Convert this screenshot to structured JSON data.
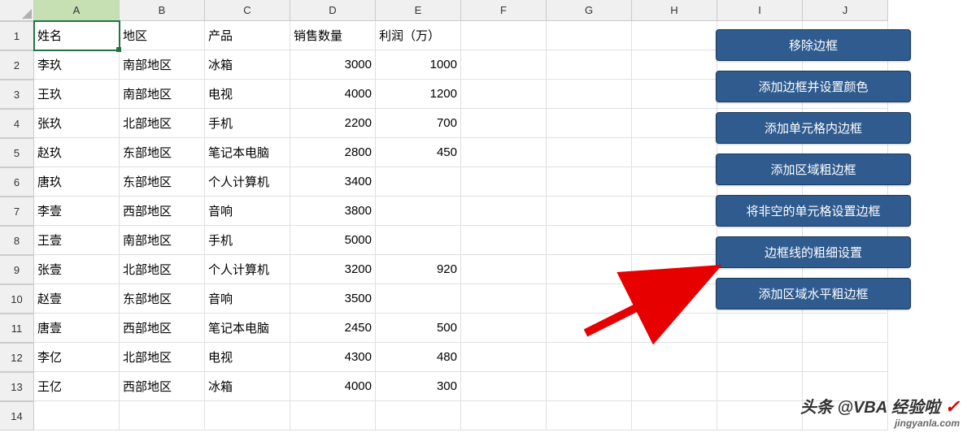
{
  "columns": [
    "A",
    "B",
    "C",
    "D",
    "E",
    "F",
    "G",
    "H",
    "I",
    "J"
  ],
  "headers": {
    "name": "姓名",
    "region": "地区",
    "product": "产品",
    "qty": "销售数量",
    "profit": "利润（万）"
  },
  "rows": [
    {
      "name": "李玖",
      "region": "南部地区",
      "product": "冰箱",
      "qty": "3000",
      "profit": "1000"
    },
    {
      "name": "王玖",
      "region": "南部地区",
      "product": "电视",
      "qty": "4000",
      "profit": "1200"
    },
    {
      "name": "张玖",
      "region": "北部地区",
      "product": "手机",
      "qty": "2200",
      "profit": "700"
    },
    {
      "name": "赵玖",
      "region": "东部地区",
      "product": "笔记本电脑",
      "qty": "2800",
      "profit": "450"
    },
    {
      "name": "唐玖",
      "region": "东部地区",
      "product": "个人计算机",
      "qty": "3400",
      "profit": ""
    },
    {
      "name": "李壹",
      "region": "西部地区",
      "product": "音响",
      "qty": "3800",
      "profit": ""
    },
    {
      "name": "王壹",
      "region": "南部地区",
      "product": "手机",
      "qty": "5000",
      "profit": ""
    },
    {
      "name": "张壹",
      "region": "北部地区",
      "product": "个人计算机",
      "qty": "3200",
      "profit": "920"
    },
    {
      "name": "赵壹",
      "region": "东部地区",
      "product": "音响",
      "qty": "3500",
      "profit": ""
    },
    {
      "name": "唐壹",
      "region": "西部地区",
      "product": "笔记本电脑",
      "qty": "2450",
      "profit": "500"
    },
    {
      "name": "李亿",
      "region": "北部地区",
      "product": "电视",
      "qty": "4300",
      "profit": "480"
    },
    {
      "name": "王亿",
      "region": "西部地区",
      "product": "冰箱",
      "qty": "4000",
      "profit": "300"
    }
  ],
  "buttons": [
    "移除边框",
    "添加边框并设置颜色",
    "添加单元格内边框",
    "添加区域粗边框",
    "将非空的单元格设置边框",
    "边框线的粗细设置",
    "添加区域水平粗边框"
  ],
  "watermark": {
    "main": "头条 @VBA 经验啦",
    "sub": "jingyanla.com",
    "check": "✓"
  },
  "row_count": 14,
  "selected_column": "A",
  "selected_cell": "A1"
}
